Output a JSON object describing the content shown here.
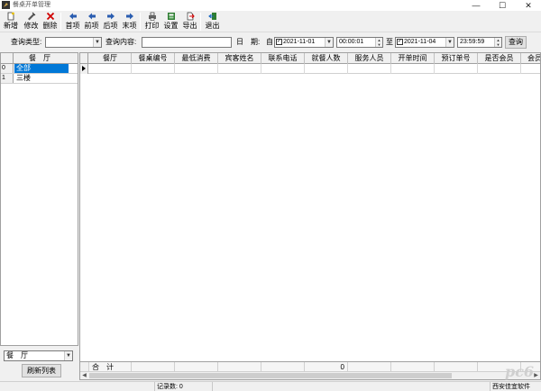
{
  "window": {
    "title": "餐桌开单管理",
    "minimize": "—",
    "maximize": "☐",
    "close": "✕"
  },
  "toolbar": {
    "new": "新增",
    "edit": "修改",
    "delete": "删除",
    "first": "首项",
    "prev": "前项",
    "next": "后项",
    "last": "末项",
    "print": "打印",
    "settings": "设置",
    "export": "导出",
    "exit": "退出"
  },
  "filter": {
    "type_label": "查询类型:",
    "type_value": "",
    "content_label": "查询内容:",
    "content_value": "",
    "date_label": "日　期:",
    "from_label": "自",
    "from_checked": true,
    "from_date": "2021-11-01",
    "from_time": "00:00:01",
    "to_label": "至",
    "to_checked": true,
    "to_date": "2021-11-04",
    "to_time": "23:59:59",
    "query_button": "查询"
  },
  "left": {
    "header": "餐　厅",
    "rows": [
      {
        "idx": "0",
        "name": "全部"
      },
      {
        "idx": "1",
        "name": "三楼"
      }
    ],
    "select_value": "餐　厅",
    "refresh_button": "刷新列表"
  },
  "grid": {
    "columns": [
      "餐厅",
      "餐桌编号",
      "最低消费",
      "宾客姓名",
      "联系电话",
      "就餐人数",
      "服务人员",
      "开单时间",
      "预订单号",
      "是否会员",
      "会员"
    ],
    "summary_label": "合　计",
    "summary_count": "0"
  },
  "status": {
    "record_count": "记录数: 0",
    "company": "西安佳宜软件"
  },
  "watermark": "pc6"
}
